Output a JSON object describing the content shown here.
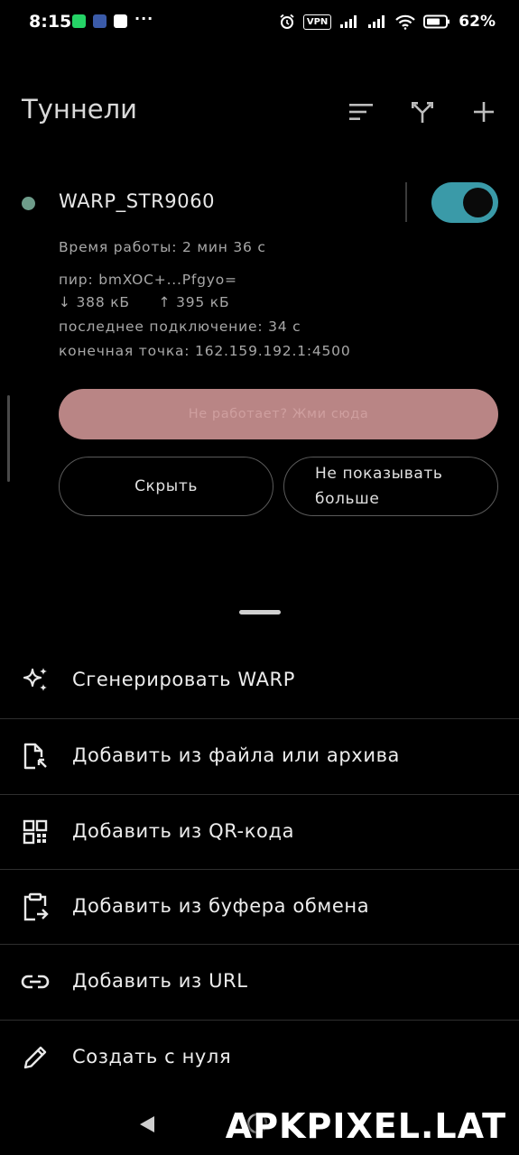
{
  "status_bar": {
    "time": "8:15",
    "more": "···",
    "vpn": "VPN",
    "battery": "62%",
    "icons": [
      "whatsapp-icon",
      "mail-icon",
      "pencil-square-icon",
      "alarm-icon",
      "signal-icon",
      "signal-icon",
      "wifi-icon",
      "battery-icon"
    ]
  },
  "header": {
    "title": "Туннели",
    "actions": [
      "sort-icon",
      "fork-icon",
      "plus-icon"
    ]
  },
  "tunnel": {
    "name": "WARP_STR9060",
    "active": true,
    "uptime": "Время работы: 2 мин 36 с",
    "peer": "пир: bmXOC+...Pfgyo=",
    "rx": "↓ 388 кБ",
    "tx": "↑ 395 кБ",
    "last_handshake": "последнее подключение: 34 с",
    "endpoint": "конечная точка: 162.159.192.1:4500",
    "status_color": "#6e9c8a",
    "toggle_color": "#3a9aa8"
  },
  "warning": {
    "label": "Не работает? Жми сюда",
    "bg_color": "#b98585",
    "text_color": "#cf9f9f"
  },
  "buttons": {
    "hide": "Скрыть",
    "dont_show_line1": "Не показывать",
    "dont_show_line2": "больше"
  },
  "menu": {
    "items": [
      {
        "label": "Сгенерировать WARP",
        "icon": "sparkle-icon"
      },
      {
        "label": "Добавить из файла или архива",
        "icon": "file-import-icon"
      },
      {
        "label": "Добавить из QR-кода",
        "icon": "qr-code-icon"
      },
      {
        "label": "Добавить из буфера обмена",
        "icon": "clipboard-icon"
      },
      {
        "label": "Добавить из URL",
        "icon": "link-icon"
      },
      {
        "label": "Создать с нуля",
        "icon": "pencil-icon"
      }
    ]
  },
  "watermark": "APKPIXEL.LAT"
}
